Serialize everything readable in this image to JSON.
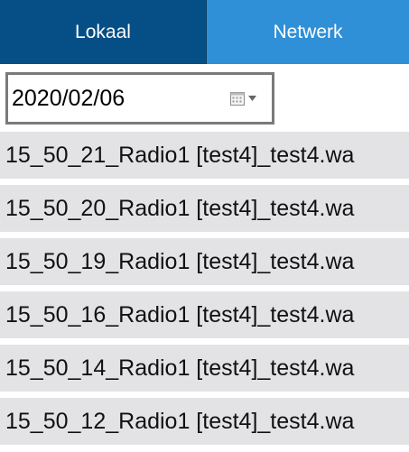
{
  "tabs": {
    "local_label": "Lokaal",
    "network_label": "Netwerk"
  },
  "date_picker": {
    "value": "2020/02/06",
    "icon": "calendar-icon"
  },
  "files": [
    "15_50_21_Radio1 [test4]_test4.wa",
    "15_50_20_Radio1 [test4]_test4.wa",
    "15_50_19_Radio1 [test4]_test4.wa",
    "15_50_16_Radio1 [test4]_test4.wa",
    "15_50_14_Radio1 [test4]_test4.wa",
    "15_50_12_Radio1 [test4]_test4.wa"
  ],
  "colors": {
    "tab_active": "#064f86",
    "tab_inactive": "#2f8fd7",
    "list_item_bg": "#e3e3e6"
  }
}
